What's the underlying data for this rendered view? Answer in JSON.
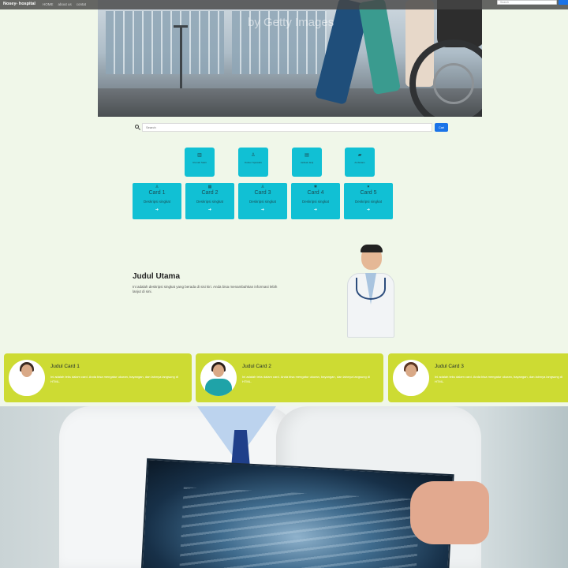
{
  "navbar": {
    "brand": "Nosey- hospital",
    "links": [
      "HOME",
      "about us",
      "contat"
    ],
    "search_placeholder": "Search"
  },
  "hero": {
    "watermark": "by Getty Images"
  },
  "search": {
    "placeholder": "Search",
    "button_label": "Cari"
  },
  "tiles": [
    {
      "icon": "hospital-icon",
      "glyph": "▥",
      "label": "Rumah Sakit"
    },
    {
      "icon": "doctor-icon",
      "glyph": "♙",
      "label": "Dokter Spesialis"
    },
    {
      "icon": "schedule-icon",
      "glyph": "▤",
      "label": "Jadwal Janji"
    },
    {
      "icon": "ambulance-icon",
      "glyph": "▰",
      "label": "Ambulans"
    }
  ],
  "cards": [
    {
      "icon": "user-icon",
      "glyph": "♙",
      "title": "Card 1",
      "desc": "Deskripsi singkat",
      "arrow": "➜"
    },
    {
      "icon": "calendar-icon",
      "glyph": "▦",
      "title": "Card 2",
      "desc": "Deskripsi singkat",
      "arrow": "➜"
    },
    {
      "icon": "person-icon",
      "glyph": "♙",
      "title": "Card 3",
      "desc": "Deskripsi singkat",
      "arrow": "➜"
    },
    {
      "icon": "gear-icon",
      "glyph": "✱",
      "title": "Card 4",
      "desc": "Deskripsi singkat",
      "arrow": "➜"
    },
    {
      "icon": "heart-icon",
      "glyph": "♥",
      "title": "Card 5",
      "desc": "Deskripsi singkat",
      "arrow": "➜"
    }
  ],
  "intro": {
    "title": "Judul Utama",
    "text": "Ini adalah deskripsi singkat yang berada di sisi kiri. Anda bisa menambahkan informasi lebih lanjut di sini."
  },
  "profile_cards": [
    {
      "title": "Judul Card 1",
      "text": "Ini adalah teks dalam card. Anda bisa mengatur ukuran, bayangan, dan lainnya langsung di HTML.",
      "hair": "#3a2a22",
      "body": "#ffffff"
    },
    {
      "title": "Judul Card 2",
      "text": "Ini adalah teks dalam card. Anda bisa mengatur ukuran, bayangan, dan lainnya langsung di HTML.",
      "hair": "#2a1f1a",
      "body": "#1fa3a8"
    },
    {
      "title": "Judul Card 3",
      "text": "Ini adalah teks dalam card. Anda bisa mengatur ukuran, bayangan, dan lainnya langsung di HTML.",
      "hair": "#5a3522",
      "body": "#ffffff"
    }
  ],
  "colors": {
    "page_bg": "#f0f7e9",
    "tile": "#11c0d4",
    "profile_card": "#cddb33",
    "primary_button": "#1a73e8"
  }
}
